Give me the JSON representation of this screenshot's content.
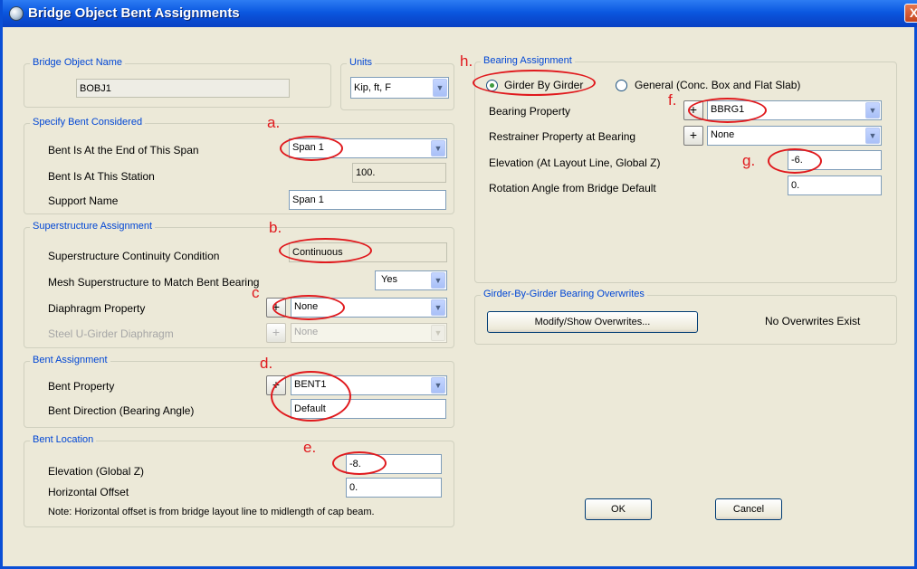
{
  "window": {
    "title": "Bridge Object Bent Assignments",
    "close_label": "X"
  },
  "bridge_object": {
    "title": "Bridge Object Name",
    "value": "BOBJ1"
  },
  "units": {
    "title": "Units",
    "value": "Kip, ft, F"
  },
  "bent_considered": {
    "title": "Specify Bent Considered",
    "end_span_label": "Bent Is At the End of This Span",
    "end_span_value": "Span 1",
    "station_label": "Bent Is At This Station",
    "station_value": "100.",
    "support_label": "Support Name",
    "support_value": "Span 1"
  },
  "superstructure": {
    "title": "Superstructure Assignment",
    "continuity_label": "Superstructure Continuity Condition",
    "continuity_value": "Continuous",
    "mesh_label": "Mesh Superstructure to Match Bent Bearing",
    "mesh_value": "Yes",
    "diaphragm_label": "Diaphragm Property",
    "diaphragm_value": "None",
    "steel_label": "Steel U-Girder Diaphragm",
    "steel_value": "None",
    "plus_label": "+"
  },
  "bent_assignment": {
    "title": "Bent Assignment",
    "property_label": "Bent Property",
    "property_value": "BENT1",
    "direction_label": "Bent Direction  (Bearing Angle)",
    "direction_value": "Default",
    "plus_label": "+"
  },
  "bent_location": {
    "title": "Bent Location",
    "elevation_label": "Elevation  (Global  Z)",
    "elevation_value": "-8.",
    "offset_label": "Horizontal Offset",
    "offset_value": "0.",
    "note": "Note:  Horizontal offset is from bridge layout line to midlength of cap beam."
  },
  "bearing": {
    "title": "Bearing Assignment",
    "radio_girder": "Girder By Girder",
    "radio_general": "General (Conc. Box and Flat Slab)",
    "property_label": "Bearing Property",
    "property_value": "BBRG1",
    "restrainer_label": "Restrainer Property at Bearing",
    "restrainer_value": "None",
    "elevation_label": "Elevation  (At Layout Line, Global  Z)",
    "elevation_value": "-6.",
    "rotation_label": "Rotation Angle from Bridge Default",
    "rotation_value": "0.",
    "plus_label": "+"
  },
  "overwrites": {
    "title": "Girder-By-Girder Bearing Overwrites",
    "button": "Modify/Show Overwrites...",
    "status": "No Overwrites Exist"
  },
  "buttons": {
    "ok": "OK",
    "cancel": "Cancel"
  },
  "annotations": {
    "a": "a.",
    "b": "b.",
    "c": "c",
    "d": "d.",
    "e": "e.",
    "f": "f.",
    "g": "g.",
    "h": "h."
  },
  "colors": {
    "annotation": "#e0191d",
    "group_title": "#0046d5",
    "titlebar": "#0a4fd6"
  },
  "icons": {
    "arrow": "▼"
  }
}
